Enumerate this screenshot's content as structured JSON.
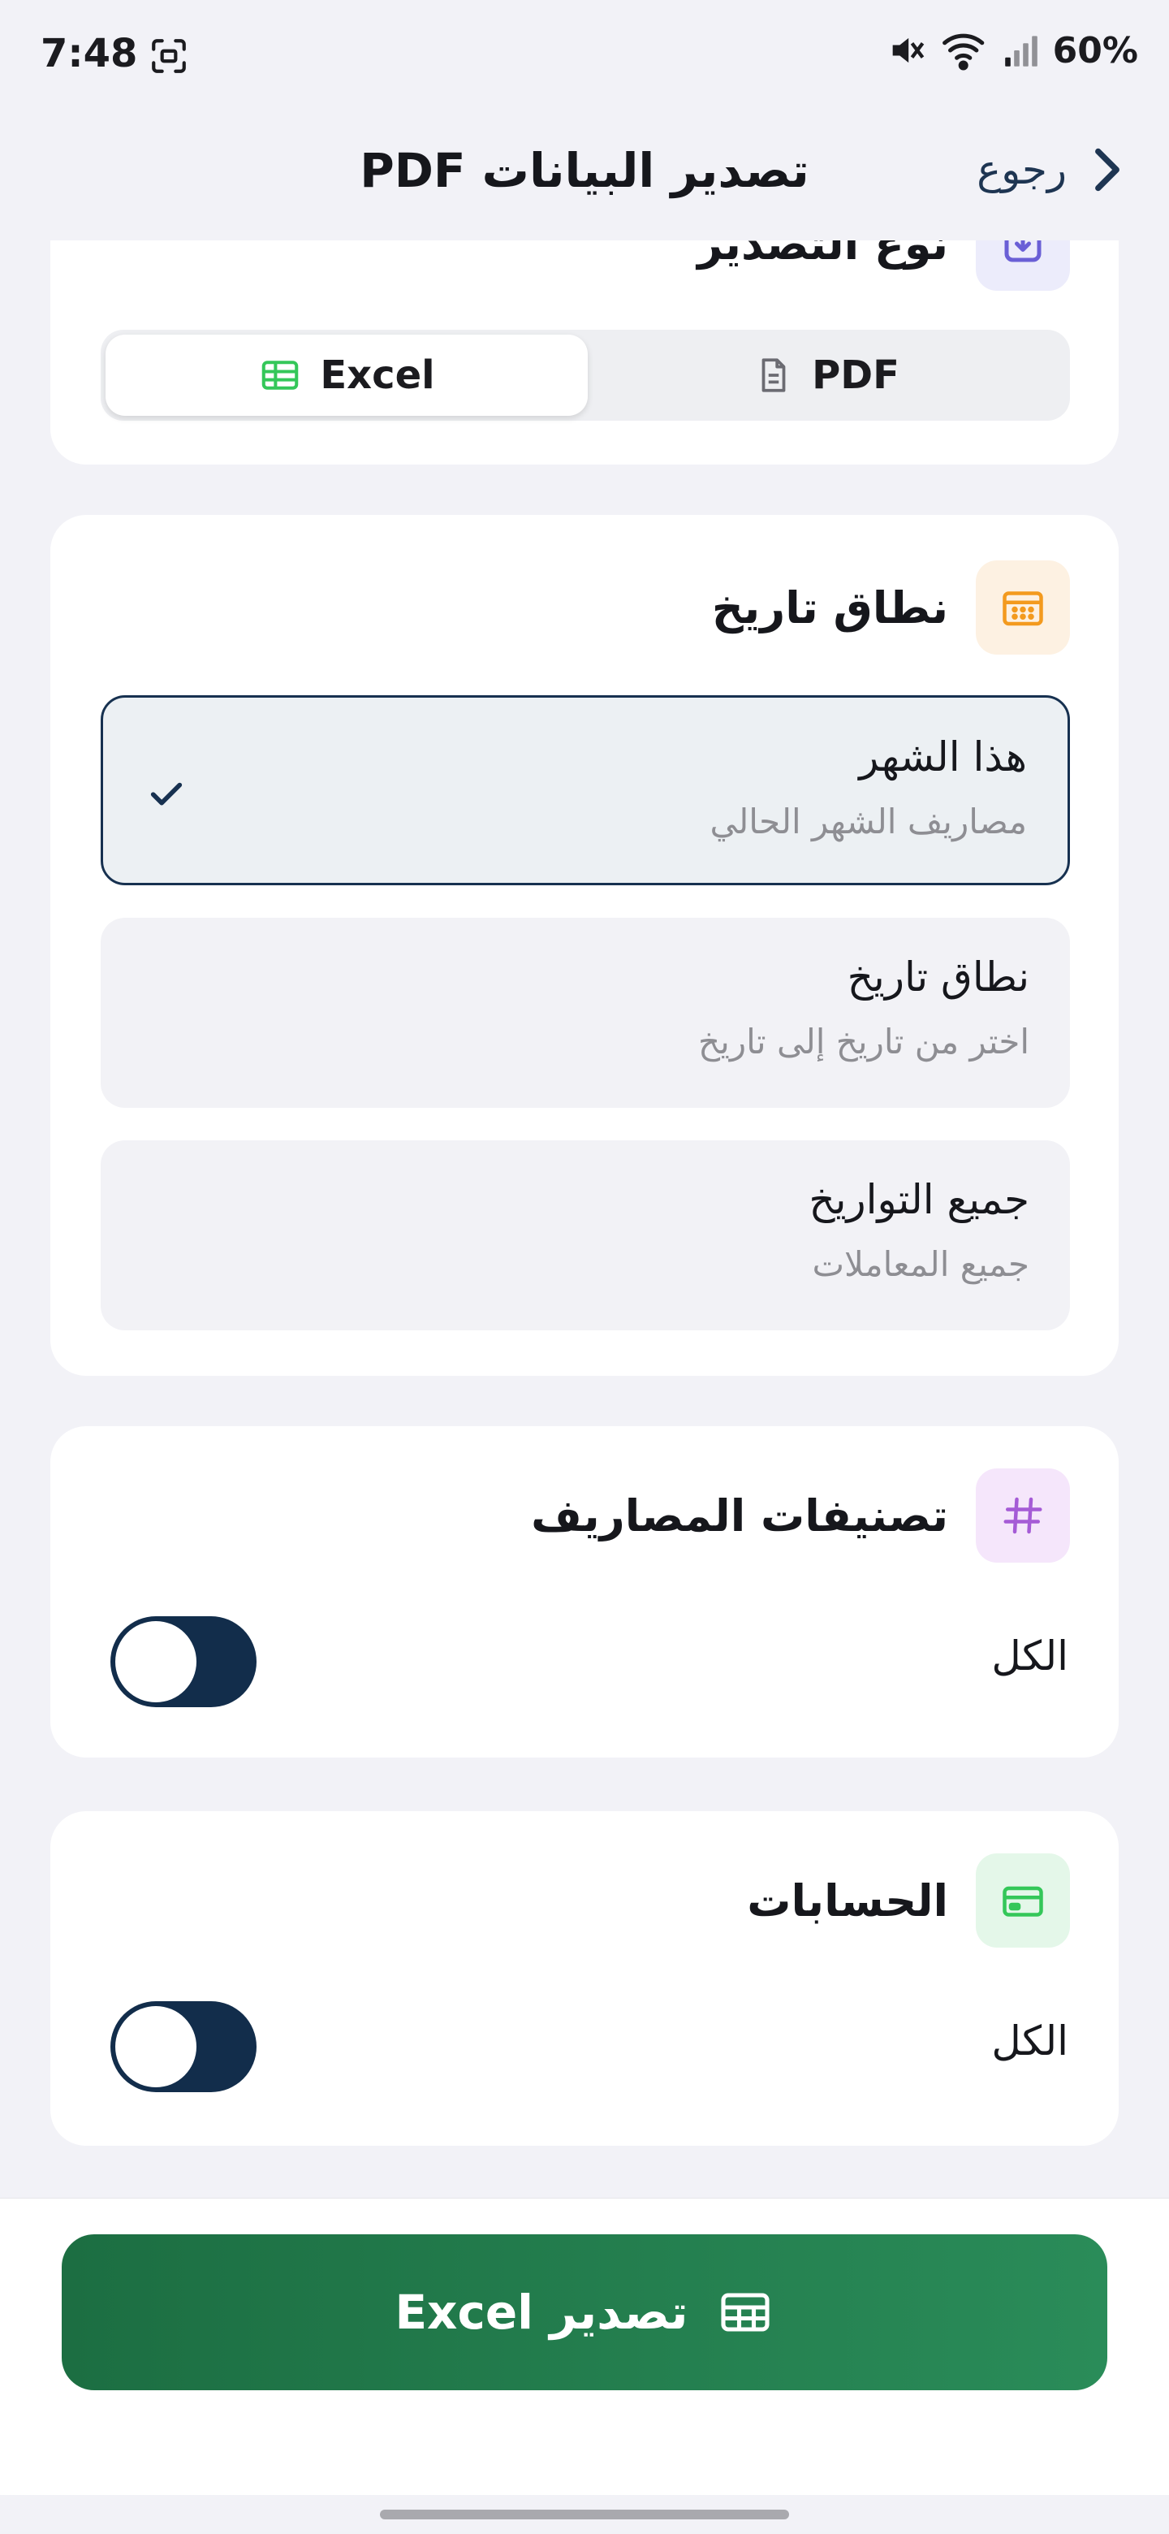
{
  "status_bar": {
    "time": "7:48",
    "battery": "60%"
  },
  "header": {
    "title": "تصدير البيانات PDF",
    "back_label": "رجوع"
  },
  "export_type": {
    "title": "نوع التصدير",
    "options": [
      {
        "label": "Excel",
        "selected": true
      },
      {
        "label": "PDF",
        "selected": false
      }
    ]
  },
  "date_range": {
    "title": "نطاق تاريخ",
    "options": [
      {
        "title": "هذا الشهر",
        "subtitle": "مصاريف الشهر الحالي",
        "selected": true
      },
      {
        "title": "نطاق تاريخ",
        "subtitle": "اختر من تاريخ إلى تاريخ",
        "selected": false
      },
      {
        "title": "جميع التواريخ",
        "subtitle": "جميع المعاملات",
        "selected": false
      }
    ]
  },
  "categories": {
    "title": "تصنيفات المصاريف",
    "all_label": "الكل",
    "toggle_on": true
  },
  "accounts": {
    "title": "الحسابات",
    "all_label": "الكل",
    "toggle_on": true
  },
  "export_button": {
    "label": "تصدير Excel"
  },
  "colors": {
    "primary_navy": "#122d4b",
    "export_green": "#1c6e42",
    "excel_icon_green": "#34c759",
    "calendar_orange": "#f39a1e",
    "category_purple": "#a55bd6",
    "account_green": "#34c759",
    "background": "#f2f2f7"
  },
  "icons": {
    "back": "chevron-right-icon",
    "export_type": "download-box-icon",
    "excel": "table-icon",
    "pdf": "document-icon",
    "date": "calendar-icon",
    "check": "check-icon",
    "categories": "hashtag-icon",
    "accounts": "credit-card-icon",
    "export": "table-icon"
  }
}
